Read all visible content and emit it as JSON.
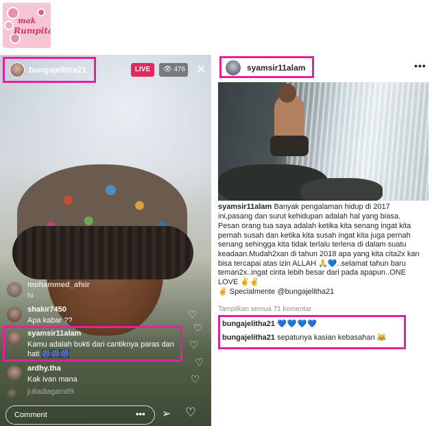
{
  "logo": {
    "line1": "mak",
    "line2": "Rumpita"
  },
  "live": {
    "username": "bungajelitha21",
    "badge": "LIVE",
    "viewers": "476",
    "close_glyph": "✕",
    "comments": [
      {
        "user": "mohammed_afsir",
        "text": "hi"
      },
      {
        "user": "shakir7450",
        "text": "Apa kabar ??"
      },
      {
        "user": "syamsir11alam",
        "text": "Kamu adalah bukti dari cantiknya paras dan hati 🎆🎆🎆"
      },
      {
        "user": "ardhy.tha",
        "text": "Kak ivan mana"
      },
      {
        "user": "juliadiagam89",
        "text": ""
      }
    ],
    "comment_placeholder": "Comment",
    "more_glyph": "•••",
    "send_glyph": "➢",
    "heart_glyph": "♡",
    "float_heart": "♡"
  },
  "post": {
    "username": "syamsir11alam",
    "more_glyph": "•••",
    "caption_user": "syamsir11alam",
    "caption_p1": "Banyak pengalaman hidup di 2017 ini,pasang dan surut kehidupan adalah hal yang biasa.",
    "caption_p2": "Pesan orang tua saya adalah ketika kita senang ingat kita pernah susah dan ketika kita susah ingat kita juga pernah senang sehingga kita tidak terlalu terlena di dalam suatu keadaan.Mudah2xan di tahun 2018 apa yang kita cita2x kan bisa tercapai atas izin ALLAH 🙏💙..selamat tahun baru teman2x..ingat cinta lebih besar dari pada apapun..ONE LOVE ✌✌",
    "caption_p3": "✌ Specialmente @bungajelitha21",
    "view_all": "Tampilkan semua 71 komentar",
    "comments": [
      {
        "user": "bungajelitha21",
        "text": "💙💙💙💙"
      },
      {
        "user": "bungajelitha21",
        "text": "sepatunya kasian kebasahan 😹"
      }
    ]
  },
  "accent": {
    "highlight": "#e3219b",
    "live": "#e4275e"
  }
}
